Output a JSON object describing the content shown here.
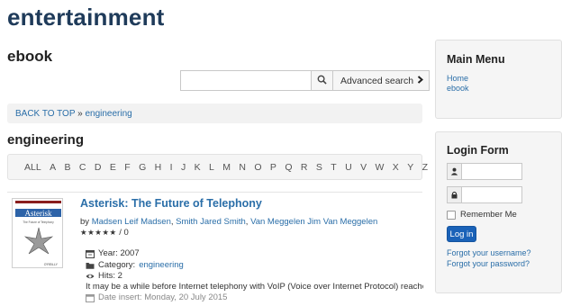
{
  "site": {
    "title": "entertainment"
  },
  "section": {
    "title": "ebook"
  },
  "search": {
    "placeholder": "",
    "advanced_label": "Advanced search",
    "search_icon": "search-icon"
  },
  "breadcrumb": {
    "back_label": "BACK TO TOP",
    "separator": "»",
    "current": "engineering"
  },
  "category": {
    "title": "engineering",
    "alphabet": [
      "ALL",
      "A",
      "B",
      "C",
      "D",
      "E",
      "F",
      "G",
      "H",
      "I",
      "J",
      "K",
      "L",
      "M",
      "N",
      "O",
      "P",
      "Q",
      "R",
      "S",
      "T",
      "U",
      "V",
      "W",
      "X",
      "Y",
      "Z"
    ]
  },
  "book": {
    "title": "Asterisk: The Future of Telephony",
    "by_label": "by",
    "authors": [
      "Madsen Leif Madsen",
      "Smith Jared Smith",
      "Van Meggelen Jim Van Meggelen"
    ],
    "author_sep": ", ",
    "stars": "★★★★★",
    "rating_count": "/ 0",
    "year": "Year: 2007",
    "category_label": "Category:",
    "category_value": "engineering",
    "hits": "Hits: 2",
    "description": "It may be a while before Internet telephony with VoIP (Voice over Internet Protocol) reaches c",
    "date_insert": "Date insert: Monday, 20 July 2015",
    "cover": {
      "title": "Asterisk",
      "subtitle": "The Future of Telephony",
      "publisher": "O'REILLY"
    }
  },
  "main_menu": {
    "heading": "Main Menu",
    "items": [
      "Home",
      "ebook"
    ]
  },
  "login": {
    "heading": "Login Form",
    "remember_label": "Remember Me",
    "button_label": "Log in",
    "forgot_username": "Forgot your username?",
    "forgot_password": "Forgot your password?"
  }
}
